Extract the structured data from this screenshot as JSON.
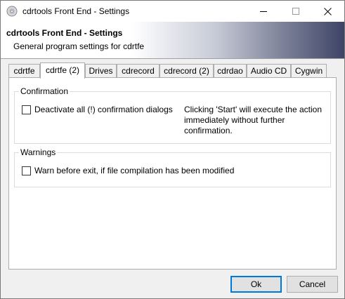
{
  "window": {
    "title": "cdrtools Front End - Settings"
  },
  "header": {
    "title": "cdrtools Front End - Settings",
    "subtitle": "General program settings for cdrtfe"
  },
  "tabs": [
    {
      "label": "cdrtfe",
      "active": false
    },
    {
      "label": "cdrtfe (2)",
      "active": true
    },
    {
      "label": "Drives",
      "active": false
    },
    {
      "label": "cdrecord",
      "active": false
    },
    {
      "label": "cdrecord (2)",
      "active": false
    },
    {
      "label": "cdrdao",
      "active": false
    },
    {
      "label": "Audio CD",
      "active": false
    },
    {
      "label": "Cygwin",
      "active": false
    }
  ],
  "confirmation": {
    "group_label": "Confirmation",
    "checkbox_label": "Deactivate all (!) confirmation dialogs",
    "checked": false,
    "hint_lines": [
      "Clicking 'Start' will execute the action",
      "immediately without further",
      "confirmation."
    ]
  },
  "warnings": {
    "group_label": "Warnings",
    "checkbox_label": "Warn before exit, if file compilation has been modified",
    "checked": false
  },
  "buttons": {
    "ok": "Ok",
    "cancel": "Cancel"
  },
  "colors": {
    "accent": "#0078d7",
    "header_gradient_end": "#3e4466"
  }
}
